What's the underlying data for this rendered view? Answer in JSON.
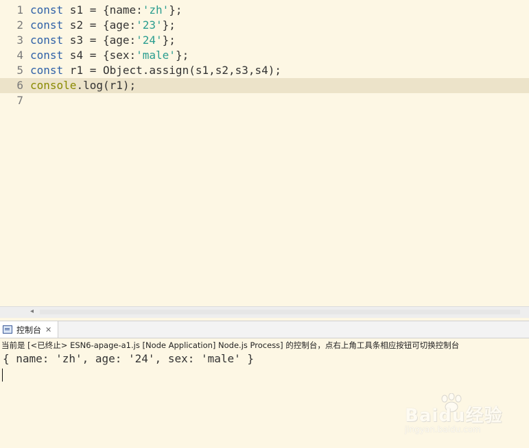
{
  "editor": {
    "lines": [
      {
        "n": "1",
        "tokens": [
          [
            "kw",
            "const"
          ],
          [
            "p",
            " s1 = {name:"
          ],
          [
            "str",
            "'zh'"
          ],
          [
            "p",
            "};"
          ]
        ]
      },
      {
        "n": "2",
        "tokens": [
          [
            "kw",
            "const"
          ],
          [
            "p",
            " s2 = {age:"
          ],
          [
            "str",
            "'23'"
          ],
          [
            "p",
            "};"
          ]
        ]
      },
      {
        "n": "3",
        "tokens": [
          [
            "kw",
            "const"
          ],
          [
            "p",
            " s3 = {age:"
          ],
          [
            "str",
            "'24'"
          ],
          [
            "p",
            "};"
          ]
        ]
      },
      {
        "n": "4",
        "tokens": [
          [
            "kw",
            "const"
          ],
          [
            "p",
            " s4 = {sex:"
          ],
          [
            "str",
            "'male'"
          ],
          [
            "p",
            "};"
          ]
        ]
      },
      {
        "n": "5",
        "tokens": [
          [
            "kw",
            "const"
          ],
          [
            "p",
            " r1 = Object.assign(s1,s2,s3,s4);"
          ]
        ]
      },
      {
        "n": "6",
        "tokens": [
          [
            "fn",
            "console"
          ],
          [
            "p",
            ".log(r1);"
          ]
        ],
        "current": true
      },
      {
        "n": "7",
        "tokens": []
      }
    ],
    "scroll_left_arrow": "◂"
  },
  "console": {
    "tab_label": "控制台",
    "tab_close": "✕",
    "description": "当前是 [<已终止> ESN6-apage-a1.js [Node Application] Node.js Process] 的控制台，点右上角工具条相应按钮可切换控制台",
    "output": "{ name: 'zh', age: '24', sex: 'male' }"
  },
  "watermark": {
    "brand": "Baidu经验",
    "sub": "jingyan.baidu.com"
  }
}
